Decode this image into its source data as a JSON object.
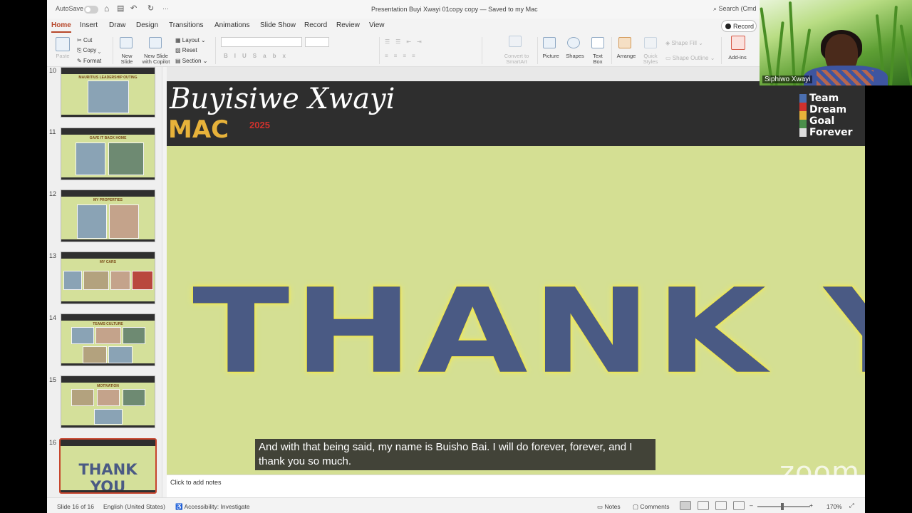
{
  "titlebar": {
    "autosave": "AutoSave",
    "document_title": "Presentation Buyi Xwayi 01copy copy — Saved to my Mac",
    "search_placeholder": "Search (Cmd"
  },
  "tabs": [
    "Home",
    "Insert",
    "Draw",
    "Design",
    "Transitions",
    "Animations",
    "Slide Show",
    "Record",
    "Review",
    "View"
  ],
  "active_tab": "Home",
  "record_button": "Record",
  "ribbon": {
    "paste": "Paste",
    "cut": "Cut",
    "copy": "Copy",
    "format": "Format",
    "new_slide": "New\nSlide",
    "new_slide_copilot": "New Slide\nwith Copilot",
    "layout": "Layout",
    "reset": "Reset",
    "section": "Section",
    "convert_smartart": "Convert to\nSmartArt",
    "picture": "Picture",
    "shapes": "Shapes",
    "text_box": "Text\nBox",
    "arrange": "Arrange",
    "quick_styles": "Quick\nStyles",
    "shape_fill": "Shape Fill",
    "shape_outline": "Shape Outline",
    "add_ins": "Add-ins"
  },
  "thumbnails": [
    {
      "number": "10",
      "title": "MAURITIUS LEADERSHIP OUTING"
    },
    {
      "number": "11",
      "title": "GAVE IT BACK HOME"
    },
    {
      "number": "12",
      "title": "MY PROPERTIES"
    },
    {
      "number": "13",
      "title": "MY CARS"
    },
    {
      "number": "14",
      "title": "TEAMS CULTURE"
    },
    {
      "number": "15",
      "title": "MOTIVATION"
    },
    {
      "number": "16",
      "title": "THANK YOU"
    }
  ],
  "slide": {
    "signature": "Buyisiwe Xwayi",
    "mac": "MAC",
    "mac_year": "2025",
    "team_lines": [
      "Team",
      "Dream",
      "Goal",
      "Forever"
    ],
    "headline": "THANK YOU"
  },
  "caption": "And with that being said, my name is Buisho Bai. I will do forever, forever, and I thank you so much.",
  "notes_placeholder": "Click to add notes",
  "status": {
    "slide_count": "Slide 16 of 16",
    "language": "English (United States)",
    "accessibility": "Accessibility: Investigate",
    "notes": "Notes",
    "comments": "Comments",
    "zoom": "170%"
  },
  "video": {
    "participant_name": "Siphiwo Xwayi",
    "watermark": "zoom"
  }
}
